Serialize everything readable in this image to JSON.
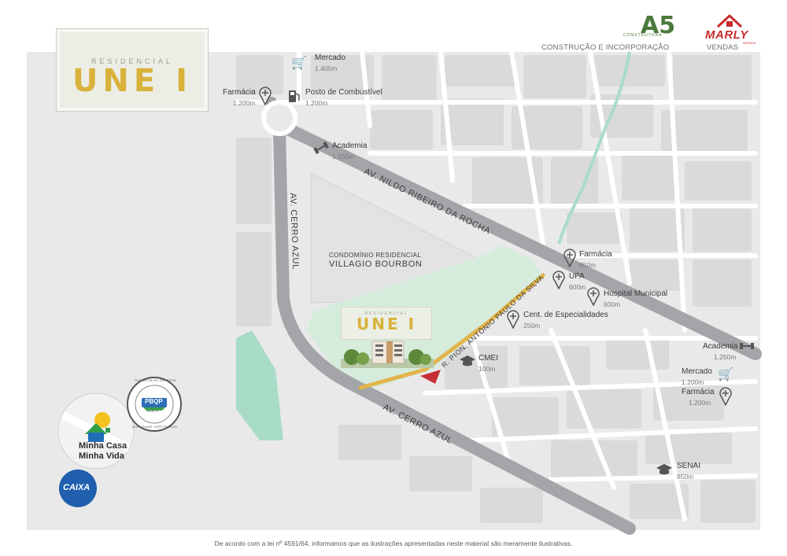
{
  "header": {
    "title_small": "RESIDENCIAL",
    "title_big": "UNE I",
    "builder_caption": "CONSTRUÇÃO E INCORPORAÇÃO",
    "builder_logo_text": "CONSTRUTORA",
    "builder_logo_mark": "A5",
    "seller_caption": "VENDAS",
    "seller_logo_text": "MARLY",
    "seller_logo_sub": "IMÓVEIS"
  },
  "streets": {
    "nildo": "AV. NILDO RIBEIRO DA ROCHA",
    "cerro_vertical": "AV. CERRO AZUL",
    "cerro_diagonal": "AV. CERRO AZUL",
    "pion": "R. PION. ANTÔNIO PAULO DA SILVA"
  },
  "condominium": {
    "line1": "CONDOMÍNIO  RESIDENCIAL",
    "line2": "VILLAGIO BOURBON"
  },
  "project_inset": {
    "title_small": "RESIDENCIAL",
    "title_big": "UNE I"
  },
  "pois": {
    "mercado_top": {
      "name": "Mercado",
      "distance": "1.400m",
      "icon": "cart-icon"
    },
    "posto": {
      "name": "Posto de Combustível",
      "distance": "1.200m",
      "icon": "fuel-pump-icon"
    },
    "farmacia_top": {
      "name": "Farmácia",
      "distance": "1.200m",
      "icon": "pharmacy-cross-icon"
    },
    "academia_top": {
      "name": "Academia",
      "distance": "1.150m",
      "icon": "dumbbell-icon"
    },
    "farmacia_mid": {
      "name": "Farmácia",
      "distance": "650m",
      "icon": "pharmacy-cross-icon"
    },
    "upa": {
      "name": "UPA",
      "distance": "600m",
      "icon": "health-cross-icon"
    },
    "hospital": {
      "name": "Hospital Municipal",
      "distance": "600m",
      "icon": "health-cross-icon"
    },
    "especialidades": {
      "name": "Cent. de Especialidades",
      "distance": "250m",
      "icon": "health-cross-icon"
    },
    "cmei": {
      "name": "CMEI",
      "distance": "100m",
      "icon": "graduation-cap-icon"
    },
    "academia_right": {
      "name": "Academia",
      "distance": "1.250m",
      "icon": "dumbbell-icon"
    },
    "mercado_right": {
      "name": "Mercado",
      "distance": "1.200m",
      "icon": "cart-icon"
    },
    "farmacia_right": {
      "name": "Farmácia",
      "distance": "1.200m",
      "icon": "pharmacy-cross-icon"
    },
    "senai": {
      "name": "SENAI",
      "distance": "850m",
      "icon": "graduation-cap-icon"
    }
  },
  "badges": {
    "mcmv_line1": "Minha Casa",
    "mcmv_line2": "Minha Vida",
    "prop_top": "GARANTIA DE ENTREGA",
    "prop_mark": "PBQP",
    "prop_level": "NÍVEL A",
    "prop_bottom": "QUALIDADE CERTIFICADA",
    "caixa": "CAIXA"
  },
  "footer": {
    "disclaimer": "De acordo com a lei nº 4591/64, informamos que as ilustrações apresentadas neste material são meramente ilustrativas."
  },
  "colors": {
    "map_bg": "#e9e9e9",
    "block": "#d9d9d9",
    "road": "#a3a5a8",
    "green": "#d8ecdf",
    "water": "#a9dcc6",
    "gold": "#e2b44a",
    "marker_red": "#c43036",
    "brand_green": "#4a7a3c",
    "brand_red": "#c92b2b"
  }
}
